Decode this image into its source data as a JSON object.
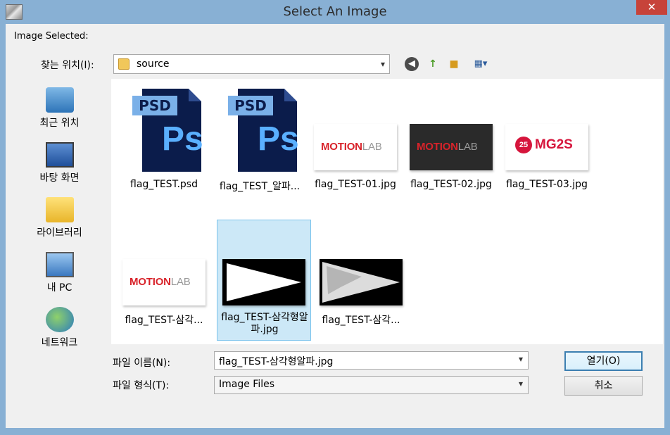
{
  "window": {
    "title": "Select An Image",
    "close_glyph": "✕"
  },
  "header": {
    "image_selected_label": "Image Selected:"
  },
  "lookin": {
    "label": "찾는 위치(I):",
    "value": "source"
  },
  "toolbar": {
    "back_icon": "back-arrow-icon",
    "up_icon": "up-folder-icon",
    "new_folder_icon": "new-folder-icon",
    "view_icon": "view-menu-icon"
  },
  "places": [
    {
      "label": "최근 위치",
      "icon": "recent-places-icon"
    },
    {
      "label": "바탕 화면",
      "icon": "desktop-icon"
    },
    {
      "label": "라이브러리",
      "icon": "libraries-icon"
    },
    {
      "label": "내 PC",
      "icon": "this-pc-icon"
    },
    {
      "label": "네트워크",
      "icon": "network-icon"
    }
  ],
  "files": [
    {
      "name": "flag_TEST.psd",
      "type": "psd"
    },
    {
      "name": "flag_TEST_알파...",
      "type": "psd"
    },
    {
      "name": "flag_TEST-01.jpg",
      "type": "jpg"
    },
    {
      "name": "flag_TEST-02.jpg",
      "type": "jpg"
    },
    {
      "name": "flag_TEST-03.jpg",
      "type": "jpg"
    },
    {
      "name": "flag_TEST-삼각...",
      "type": "jpg"
    },
    {
      "name": "flag_TEST-삼각형알파.jpg",
      "type": "jpg",
      "selected": true
    },
    {
      "name": "flag_TEST-삼각...",
      "type": "jpg"
    }
  ],
  "thumb_text": {
    "psd_tag": "PSD",
    "ps_mark": "Ps",
    "motion_a": "MOTION",
    "motion_b": "LAB",
    "mgs_ring": "25",
    "mgs_text": "MG2S"
  },
  "form": {
    "filename_label": "파일 이름(N):",
    "filename_value": "flag_TEST-삼각형알파.jpg",
    "filetype_label": "파일 형식(T):",
    "filetype_value": "Image Files",
    "open_label": "열기(O)",
    "cancel_label": "취소"
  },
  "colors": {
    "frame": "#88b0d4",
    "selection": "#cce8f7",
    "close": "#c7433a"
  }
}
